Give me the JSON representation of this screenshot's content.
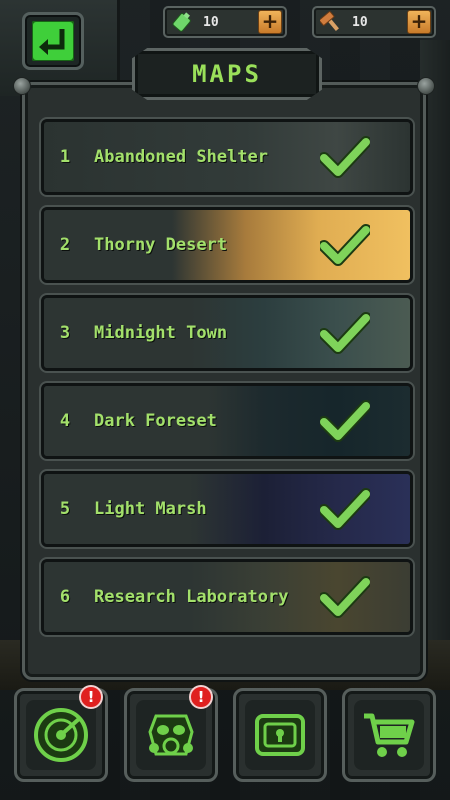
{
  "resources": [
    {
      "icon": "fuel-canister-icon",
      "value": "10",
      "plus": "+"
    },
    {
      "icon": "hammer-icon",
      "value": "10",
      "plus": "+"
    }
  ],
  "title": "MAPS",
  "maps": [
    {
      "number": "1",
      "name": "Abandoned Shelter",
      "completed": true
    },
    {
      "number": "2",
      "name": "Thorny Desert",
      "completed": true
    },
    {
      "number": "3",
      "name": "Midnight Town",
      "completed": true
    },
    {
      "number": "4",
      "name": "Dark Foreset",
      "completed": true
    },
    {
      "number": "5",
      "name": "Light Marsh",
      "completed": true
    },
    {
      "number": "6",
      "name": "Research Laboratory",
      "completed": true
    }
  ],
  "nav": [
    {
      "icon": "radar-icon",
      "badge": "!"
    },
    {
      "icon": "gas-mask-icon",
      "badge": "!"
    },
    {
      "icon": "vault-icon",
      "badge": ""
    },
    {
      "icon": "shopping-cart-icon",
      "badge": ""
    }
  ],
  "colors": {
    "accent_green": "#9ae05a",
    "badge_red": "#e0201f",
    "plus_orange": "#e09a45"
  }
}
